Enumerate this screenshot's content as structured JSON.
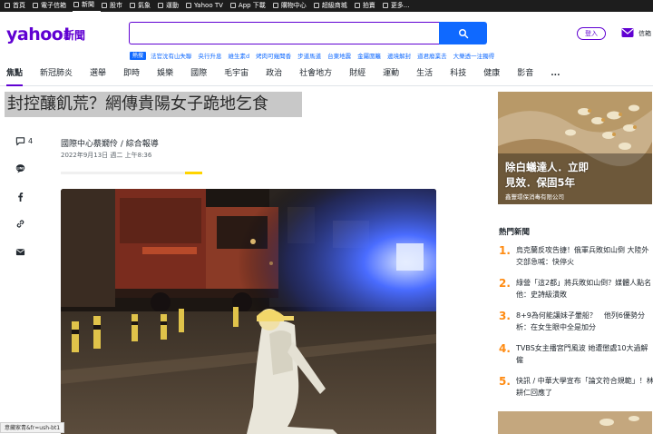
{
  "topnav": [
    "首頁",
    "電子信箱",
    "新聞",
    "股市",
    "氣象",
    "運動",
    "Yahoo TV",
    "App 下載",
    "購物中心",
    "超級商城",
    "拍賣",
    "更多..."
  ],
  "topnav_active": 2,
  "logo": {
    "main": "yahoo!",
    "sub": "新聞"
  },
  "search": {
    "placeholder": ""
  },
  "trending": {
    "tag": "熱搜",
    "links": [
      "法官沈有山失聯",
      "央行升息",
      "維生素d",
      "烤肉可幾聞香",
      "步道馬道",
      "台東地震",
      "金屬圍籬",
      "邊境解封",
      "道君廢業去",
      "大樂透一注獨得"
    ]
  },
  "header_right": {
    "login": "登入",
    "mail": "信箱"
  },
  "categories": [
    "焦點",
    "新冠肺炎",
    "選舉",
    "即時",
    "娛樂",
    "國際",
    "毛宇宙",
    "政治",
    "社會地方",
    "財經",
    "運動",
    "生活",
    "科技",
    "健康",
    "影音"
  ],
  "categories_more": "...",
  "article": {
    "headline": "封控釀飢荒？網傳貴陽女子跪地乞食",
    "comment_count": "4",
    "author": "國際中心蔡嫺伶 / 綜合報導",
    "date": "2022年9月13日 週二 上午8:36"
  },
  "ad": {
    "title": "除白蟻達人．立即",
    "subtitle": "見效．保固5年",
    "sponsor": "鑫豐環保消毒有限公司"
  },
  "hot": {
    "title": "熱門新聞",
    "items": [
      {
        "num": "1.",
        "text": "烏克蘭反攻告捷！俄軍兵敗如山倒 大陸外交部急喊：快停火"
      },
      {
        "num": "2.",
        "text": "綠營「這2都」將兵敗如山倒？媒體人點名他：史詩級潰敗"
      },
      {
        "num": "3.",
        "text": "8+9為何能讓妹子暈船？　他列6優勢分析：在女生眼中全是加分"
      },
      {
        "num": "4.",
        "text": "TVBS女主播宮門風波 她遭懲處10大過解僱"
      },
      {
        "num": "5.",
        "text": "快訊 / 中華大學宣布「論文符合規範」！林耕仁回應了"
      }
    ]
  },
  "statusbar": "意藏家青&fr=ush-bt1",
  "colors": {
    "brand": "#6001d2",
    "search_button": "#0f69ff",
    "hot_number": "#ff8b12",
    "topbar": "#1d1d1d"
  }
}
